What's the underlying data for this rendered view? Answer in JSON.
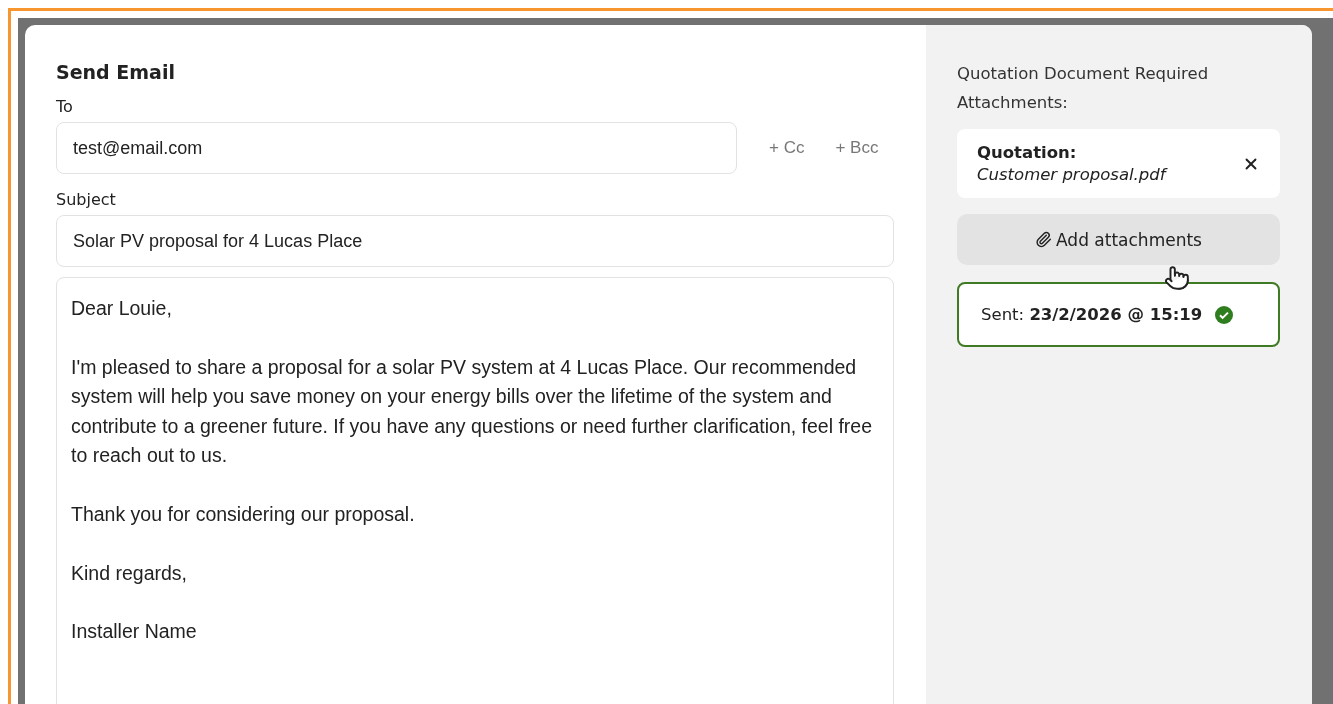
{
  "dialog": {
    "title": "Send Email",
    "to": {
      "label": "To",
      "value": "test@email.com"
    },
    "copy_links": [
      "+ Cc",
      "+ Bcc"
    ],
    "subject": {
      "label": "Subject",
      "value": "Solar PV proposal for 4 Lucas Place"
    },
    "message": [
      "Dear Louie,",
      "I'm pleased to share a proposal for a solar PV system at 4 Lucas Place. Our recommended system will help you save money on your energy bills over the lifetime of the system and contribute to a greener future. If you have any questions or need further clarification, feel free to reach out to us.",
      "Thank you for considering our proposal.",
      "Kind regards,",
      "Installer Name"
    ]
  },
  "attachments_panel": {
    "heading": "Quotation Document Required Attachments:",
    "attachments": [
      {
        "label": "Quotation:",
        "file": "Customer proposal.pdf"
      }
    ],
    "add_button": "Add attachments",
    "sent": {
      "label": "Sent:",
      "time": "23/2/2026 @ 15:19"
    }
  }
}
